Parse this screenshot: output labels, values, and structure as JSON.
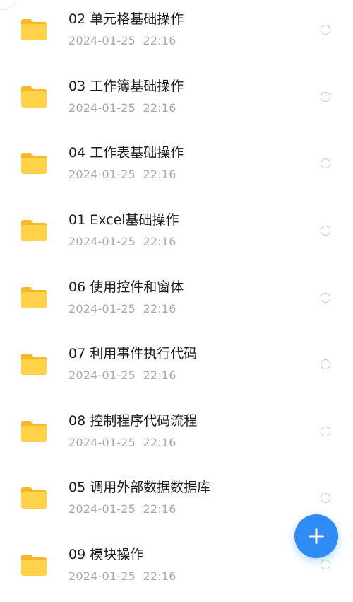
{
  "icons": {
    "folder": "folder-icon",
    "add": "plus-icon",
    "select": "radio-circle-icon"
  },
  "colors": {
    "folder_front": "#ffd24a",
    "folder_back": "#f5b829",
    "accent": "#2f8cf5"
  },
  "files": [
    {
      "name": "02 单元格基础操作",
      "date": "2024-01-25  22:16"
    },
    {
      "name": "03 工作簿基础操作",
      "date": "2024-01-25  22:16"
    },
    {
      "name": "04 工作表基础操作",
      "date": "2024-01-25  22:16"
    },
    {
      "name": "01 Excel基础操作",
      "date": "2024-01-25  22:16"
    },
    {
      "name": "06 使用控件和窗体",
      "date": "2024-01-25  22:16"
    },
    {
      "name": "07 利用事件执行代码",
      "date": "2024-01-25  22:16"
    },
    {
      "name": "08 控制程序代码流程",
      "date": "2024-01-25  22:16"
    },
    {
      "name": "05 调用外部数据数据库",
      "date": "2024-01-25  22:16"
    },
    {
      "name": "09 模块操作",
      "date": "2024-01-25  22:16"
    }
  ]
}
